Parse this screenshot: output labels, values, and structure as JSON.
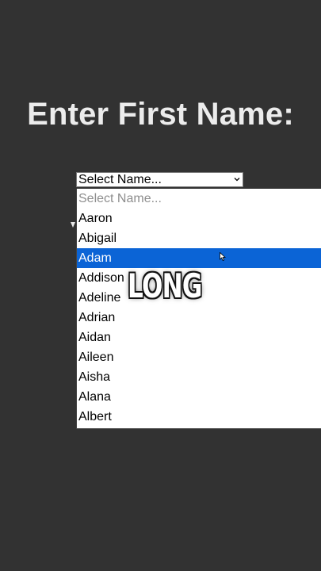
{
  "heading": "Enter First Name:",
  "select": {
    "value": "Select Name...",
    "chevron_icon": "chevron-down-icon"
  },
  "dropdown": {
    "options": [
      "Select Name...",
      "Aaron",
      "Abigail",
      "Adam",
      "Addison",
      "Adeline",
      "Adrian",
      "Aidan",
      "Aileen",
      "Aisha",
      "Alana",
      "Albert"
    ],
    "highlighted": "Adam"
  },
  "overlay_caption": "LONG",
  "colors": {
    "background": "#323232",
    "highlight": "#0b64d6",
    "heading_text": "#ececec"
  }
}
